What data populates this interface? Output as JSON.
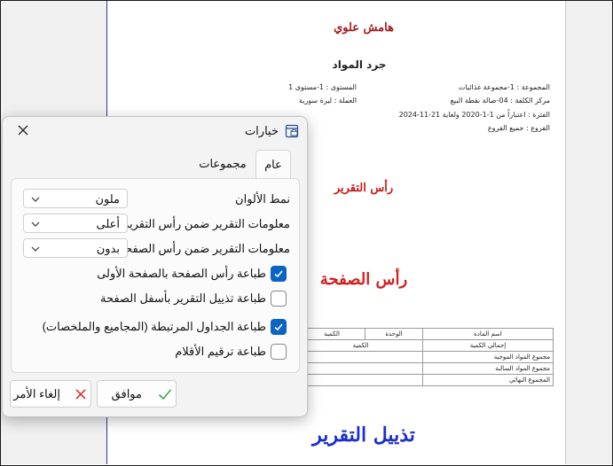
{
  "preview": {
    "top_margin": "هامش علوي",
    "doc_title": "جرد المواد",
    "meta": {
      "group": {
        "label": "المجموعة",
        "value": ": 1-مجموعة غذائيات"
      },
      "level": {
        "label": "المستوى",
        "value": ": 1-مستوى 1"
      },
      "cost_center": {
        "label": "مركز الكلفة",
        "value": ": 04-صالة نقطة البيع"
      },
      "currency": {
        "label": "العملة",
        "value": ": ليرة سورية"
      },
      "period": {
        "label": "الفترة",
        "value": ": اعتباراً من 1-1-2020 ولغاية 21-11-2024"
      },
      "branches": {
        "label": "الفروع",
        "value": ": جميع الفروع"
      }
    },
    "report_header": "رأس التقرير",
    "page_header": "رأس الصفحة",
    "table": {
      "head": [
        "اسم المادة",
        "الوحدة",
        "الكمية"
      ],
      "summary_head": [
        "إجمالي الكمية",
        "الكمية"
      ],
      "rows": [
        "مجموع المواد الموجبة",
        "مجموع المواد السالبة",
        "المجموع النهائي"
      ]
    },
    "report_footer": "تذييل التقرير"
  },
  "dialog": {
    "title": "خيارات",
    "close_icon": "close-icon",
    "tabs": [
      {
        "label": "عام",
        "active": true
      },
      {
        "label": "مجموعات",
        "active": false
      }
    ],
    "fields": [
      {
        "label": "نمط الألوان",
        "value": "ملون"
      },
      {
        "label": "معلومات التقرير ضمن رأس التقرير",
        "value": "أعلى"
      },
      {
        "label": "معلومات التقرير ضمن رأس الصفحة",
        "value": "بدون"
      }
    ],
    "checkboxes": [
      {
        "label": "طباعة رأس الصفحة بالصفحة الأولى",
        "checked": true
      },
      {
        "label": "طباعة تذييل التقرير بأسفل الصفحة",
        "checked": false
      },
      {
        "label": "طباعة الجداول المرتبطة (المجاميع والملخصات)",
        "checked": true
      },
      {
        "label": "طباعة ترقيم الأقلام",
        "checked": false
      }
    ],
    "ok_label": "موافق",
    "cancel_label": "إلغاء الأمر",
    "colors": {
      "accent": "#0b63c4",
      "ok_check": "#3aa655",
      "cancel_x": "#d23a3a"
    }
  }
}
